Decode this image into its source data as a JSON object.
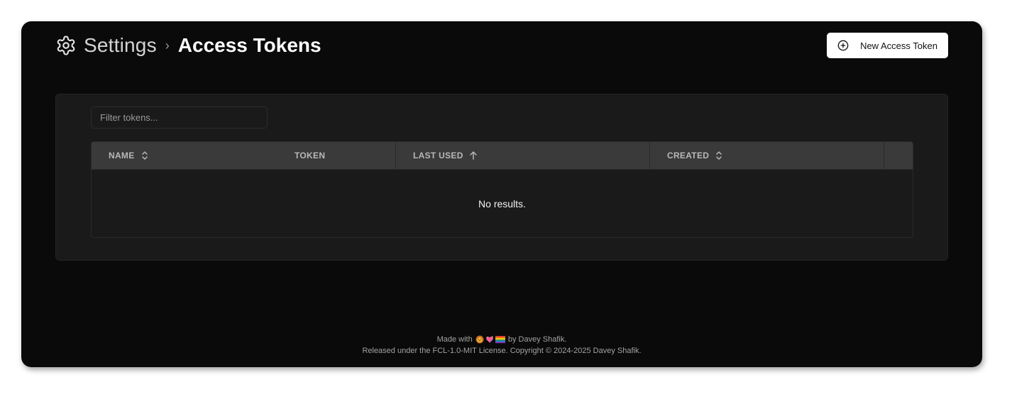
{
  "breadcrumb": {
    "root": "Settings",
    "separator": "›",
    "current": "Access Tokens"
  },
  "actions": {
    "new_token_label": "New Access Token"
  },
  "filter": {
    "placeholder": "Filter tokens..."
  },
  "table": {
    "columns": [
      {
        "label": "NAME",
        "sort": "unsorted"
      },
      {
        "label": "TOKEN"
      },
      {
        "label": "LAST USED",
        "sort": "ascending"
      },
      {
        "label": "CREATED",
        "sort": "unsorted"
      }
    ],
    "empty_message": "No results."
  },
  "footer": {
    "made_with": "Made with",
    "by_author": "by Davey Shafik.",
    "license": "Released under the FCL-1.0-MIT License. Copyright © 2024-2025 Davey Shafik."
  },
  "icons": {
    "settings": "gear-icon",
    "new_token": "plus-circle-icon",
    "sort_unsorted": "chevron-up-down-icon",
    "sort_ascending": "arrow-up-icon",
    "footer_emojis": [
      "lion-face-icon",
      "sparkling-heart-icon",
      "rainbow-flag-icon"
    ]
  },
  "colors": {
    "background": "#0a0a0b",
    "panel": "#1a1a1b",
    "table_header": "#3a3a3b",
    "button_bg": "#ffffff"
  }
}
